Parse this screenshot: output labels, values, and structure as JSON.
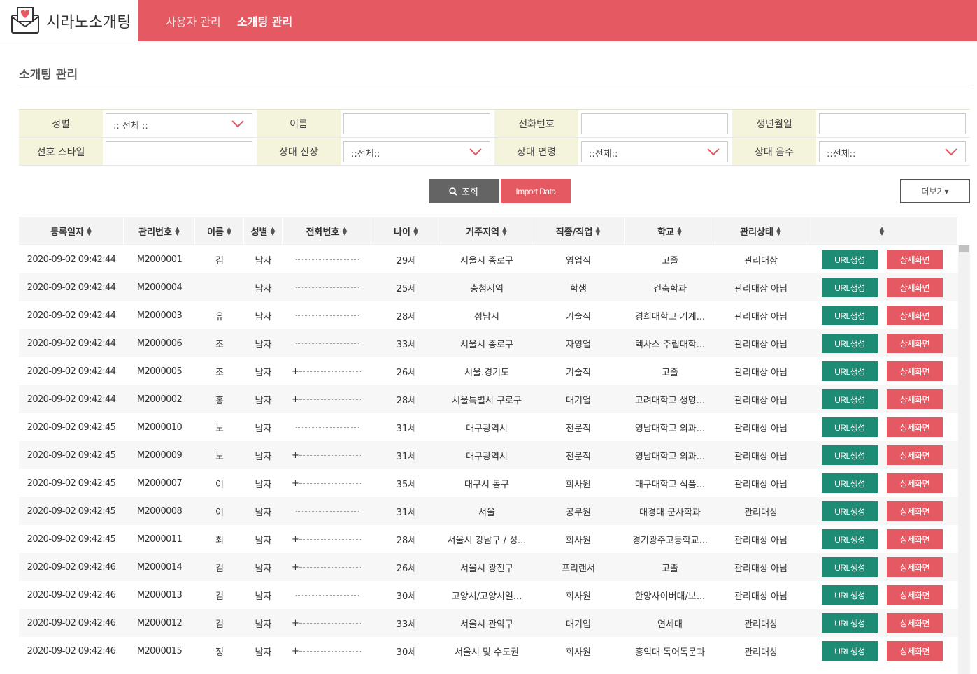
{
  "brand": {
    "name": "시라노소개팅",
    "icon": "envelope-heart-icon"
  },
  "nav": {
    "items": [
      "사용자 관리",
      "소개팅 관리"
    ],
    "active_index": 1
  },
  "page": {
    "title": "소개팅 관리"
  },
  "filters": {
    "row1": [
      {
        "label": "성별",
        "type": "select",
        "value": ":: 전체 ::"
      },
      {
        "label": "이름",
        "type": "input",
        "value": ""
      },
      {
        "label": "전화번호",
        "type": "input",
        "value": ""
      },
      {
        "label": "생년월일",
        "type": "input",
        "value": ""
      }
    ],
    "row2": [
      {
        "label": "선호 스타일",
        "type": "input",
        "value": ""
      },
      {
        "label": "상대 신장",
        "type": "select",
        "value": "::전체::"
      },
      {
        "label": "상대 연령",
        "type": "select",
        "value": "::전체::"
      },
      {
        "label": "상대 음주",
        "type": "select",
        "value": "::전체::"
      }
    ]
  },
  "buttons": {
    "search": "조회",
    "import": "Import Data",
    "more": "더보기▾"
  },
  "table": {
    "columns": [
      "등록일자",
      "관리번호",
      "이름",
      "성별",
      "전화번호",
      "나이",
      "거주지역",
      "직종/직업",
      "학교",
      "관리상태",
      ""
    ],
    "action_labels": {
      "url": "URL생성",
      "detail": "상세화면"
    },
    "rows": [
      {
        "date": "2020-09-02 09:42:44",
        "id": "M2000001",
        "name": "김",
        "gender": "남자",
        "phone": "",
        "age": "29세",
        "region": "서울시 종로구",
        "job": "영업직",
        "school": "고졸",
        "status": "관리대상"
      },
      {
        "date": "2020-09-02 09:42:44",
        "id": "M2000004",
        "name": "",
        "gender": "남자",
        "phone": "",
        "age": "25세",
        "region": "충청지역",
        "job": "학생",
        "school": "건축학과",
        "status": "관리대상 아님"
      },
      {
        "date": "2020-09-02 09:42:44",
        "id": "M2000003",
        "name": "유",
        "gender": "남자",
        "phone": "",
        "age": "28세",
        "region": "성남시",
        "job": "기술직",
        "school": "경희대학교 기계...",
        "status": "관리대상 아님"
      },
      {
        "date": "2020-09-02 09:42:44",
        "id": "M2000006",
        "name": "조",
        "gender": "남자",
        "phone": "",
        "age": "33세",
        "region": "서울시 종로구",
        "job": "자영업",
        "school": "텍사스 주립대학...",
        "status": "관리대상 아님"
      },
      {
        "date": "2020-09-02 09:42:44",
        "id": "M2000005",
        "name": "조",
        "gender": "남자",
        "phone": "+",
        "age": "26세",
        "region": "서울.경기도",
        "job": "기술직",
        "school": "고졸",
        "status": "관리대상 아님"
      },
      {
        "date": "2020-09-02 09:42:44",
        "id": "M2000002",
        "name": "홍",
        "gender": "남자",
        "phone": "+",
        "age": "28세",
        "region": "서울특별시 구로구",
        "job": "대기업",
        "school": "고려대학교 생명...",
        "status": "관리대상 아님"
      },
      {
        "date": "2020-09-02 09:42:45",
        "id": "M2000010",
        "name": "노",
        "gender": "남자",
        "phone": "",
        "age": "31세",
        "region": "대구광역시",
        "job": "전문직",
        "school": "영남대학교 의과...",
        "status": "관리대상 아님"
      },
      {
        "date": "2020-09-02 09:42:45",
        "id": "M2000009",
        "name": "노",
        "gender": "남자",
        "phone": "+",
        "age": "31세",
        "region": "대구광역시",
        "job": "전문직",
        "school": "영남대학교 의과...",
        "status": "관리대상 아님"
      },
      {
        "date": "2020-09-02 09:42:45",
        "id": "M2000007",
        "name": "이",
        "gender": "남자",
        "phone": "+",
        "age": "35세",
        "region": "대구시 동구",
        "job": "회사원",
        "school": "대구대학교 식품...",
        "status": "관리대상 아님"
      },
      {
        "date": "2020-09-02 09:42:45",
        "id": "M2000008",
        "name": "이",
        "gender": "남자",
        "phone": "",
        "age": "31세",
        "region": "서울",
        "job": "공무원",
        "school": "대경대 군사학과",
        "status": "관리대상"
      },
      {
        "date": "2020-09-02 09:42:45",
        "id": "M2000011",
        "name": "최",
        "gender": "남자",
        "phone": "+",
        "age": "28세",
        "region": "서울시 강남구 / 성...",
        "job": "회사원",
        "school": "경기광주고등학교...",
        "status": "관리대상 아님"
      },
      {
        "date": "2020-09-02 09:42:46",
        "id": "M2000014",
        "name": "김",
        "gender": "남자",
        "phone": "+",
        "age": "26세",
        "region": "서울시 광진구",
        "job": "프리랜서",
        "school": "고졸",
        "status": "관리대상 아님"
      },
      {
        "date": "2020-09-02 09:42:46",
        "id": "M2000013",
        "name": "김",
        "gender": "남자",
        "phone": "",
        "age": "30세",
        "region": "고양시/고양시일...",
        "job": "회사원",
        "school": "한양사이버대/보...",
        "status": "관리대상 아님"
      },
      {
        "date": "2020-09-02 09:42:46",
        "id": "M2000012",
        "name": "김",
        "gender": "남자",
        "phone": "+",
        "age": "33세",
        "region": "서울시 관악구",
        "job": "대기업",
        "school": "연세대",
        "status": "관리대상"
      },
      {
        "date": "2020-09-02 09:42:46",
        "id": "M2000015",
        "name": "정",
        "gender": "남자",
        "phone": "+",
        "age": "30세",
        "region": "서울시 및 수도권",
        "job": "회사원",
        "school": "홍익대 독어독문과",
        "status": "관리대상"
      }
    ]
  },
  "colors": {
    "accent": "#e55a62",
    "url_button": "#1e8c74",
    "filter_label_bg": "#f4f3dc",
    "search_button": "#646464"
  }
}
